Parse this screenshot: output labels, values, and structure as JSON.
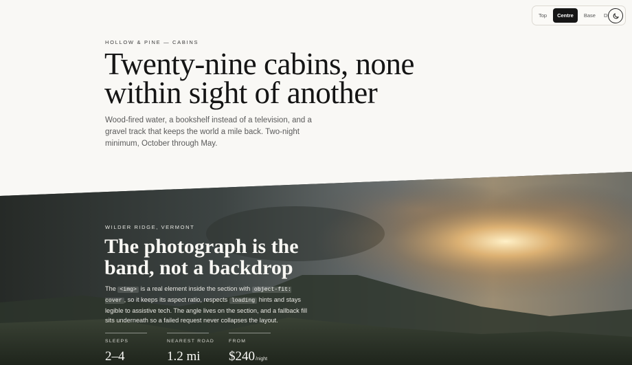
{
  "toolbar": {
    "items": [
      {
        "label": "Top",
        "active": false
      },
      {
        "label": "Centre",
        "active": true
      },
      {
        "label": "Base",
        "active": false
      },
      {
        "label": "Duo",
        "active": false
      }
    ],
    "theme_toggle_icon": "moon-icon"
  },
  "hero": {
    "eyebrow": "HOLLOW & PINE — CABINS",
    "title_line1": "Twenty-nine cabins, none",
    "title_line2": "within sight of another",
    "lede": "Wood-fired water, a bookshelf instead of a television, and a gravel track that keeps the world a mile back. Two-night minimum, October through May."
  },
  "band": {
    "eyebrow": "WILDER RIDGE, VERMONT",
    "title": "The photograph is the band, not a backdrop",
    "body": {
      "t1": "The ",
      "code1": "<img>",
      "t2": " is a real element inside the section with ",
      "code2": "object-fit: cover",
      "t3": ", so it keeps its aspect ratio, respects ",
      "code3": "loading",
      "t4": " hints and stays legible to assistive tech. The angle lives on the section, and a fallback fill sits underneath so a failed request never collapses the layout."
    },
    "stats": [
      {
        "label": "SLEEPS",
        "value": "2–4",
        "unit": ""
      },
      {
        "label": "NEAREST ROAD",
        "value": "1.2 mi",
        "unit": ""
      },
      {
        "label": "FROM",
        "value": "$240",
        "unit": "/night"
      }
    ]
  },
  "colors": {
    "page_background": "#f9f8f5",
    "active_tool": "#161616",
    "band_fallback": "#2c3029"
  }
}
